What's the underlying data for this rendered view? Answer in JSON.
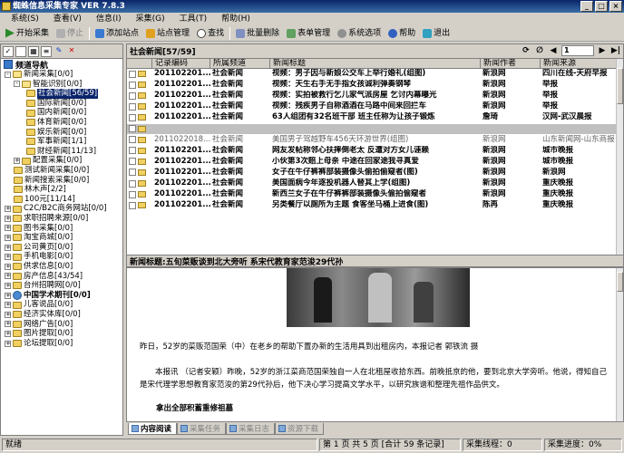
{
  "window": {
    "title": "蜘蛛信息采集专家 VER 7.8.3"
  },
  "menu": [
    "系统(S)",
    "查看(V)",
    "信息(I)",
    "采集(G)",
    "工具(T)",
    "帮助(H)"
  ],
  "toolbar": {
    "start": "开始采集",
    "stop": "停止",
    "add_site": "添加站点",
    "site_manage": "站点管理",
    "find": "查找",
    "batch_delete": "批量删除",
    "form_manage": "表单管理",
    "options": "系统选项",
    "help": "帮助",
    "exit": "退出"
  },
  "sidebar": {
    "title": "频道导航",
    "items": [
      {
        "label": "新闻采集[0/0]"
      },
      {
        "label": "智能识别[0/0]"
      },
      {
        "label": "社会新闻[56/59]"
      },
      {
        "label": "国际新闻[0/0]"
      },
      {
        "label": "国内新闻[0/0]"
      },
      {
        "label": "体育新闻[0/0]"
      },
      {
        "label": "娱乐新闻[0/0]"
      },
      {
        "label": "军事新闻[1/1]"
      },
      {
        "label": "财经新闻[11/13]"
      },
      {
        "label": "配置采集[0/0]"
      },
      {
        "label": "测试新闻采集[0/0]"
      },
      {
        "label": "新闻搜索采集[0/0]"
      },
      {
        "label": "林木声[2/2]"
      },
      {
        "label": "100元[11/14]"
      },
      {
        "label": "C2C/B2C商务网站[0/0]"
      },
      {
        "label": "求职招聘来源[0/0]"
      },
      {
        "label": "图书采集[0/0]"
      },
      {
        "label": "淘宝商城[0/0]"
      },
      {
        "label": "公司黄页[0/0]"
      },
      {
        "label": "手机电影[0/0]"
      },
      {
        "label": "供求信息[0/0]"
      },
      {
        "label": "房产信息[43/54]"
      },
      {
        "label": "台州招聘网[0/0]"
      },
      {
        "label": "中国学术期刊[0/0]"
      },
      {
        "label": "儿客说品[0/0]"
      },
      {
        "label": "经济实体库[0/0]"
      },
      {
        "label": "网络广告[0/0]"
      },
      {
        "label": "图片提取[0/0]"
      },
      {
        "label": "论坛提取[0/0]"
      }
    ]
  },
  "list": {
    "title": "社会新闻[57/59]",
    "page_select": "1",
    "columns": [
      "记录编码",
      "所属频道",
      "新闻标题",
      "新闻作者",
      "新闻来源"
    ],
    "rows": [
      {
        "id": "201102201...",
        "ch": "社会新闻",
        "title": "视频：男子因与新娘公交车上举行婚礼(组图)",
        "author": "新浪网",
        "src": "四川在线-天府早报"
      },
      {
        "id": "201102201...",
        "ch": "社会新闻",
        "title": "视频：天生右手无手指女孩诚利弹奏钢琴",
        "author": "新浪网",
        "src": "举报"
      },
      {
        "id": "201102201...",
        "ch": "社会新闻",
        "title": "视频：实拍被救行乞儿家气派房屋 乞讨内幕曝光",
        "author": "新浪网",
        "src": "举报"
      },
      {
        "id": "201102201...",
        "ch": "社会新闻",
        "title": "视频：残疾男子自称酒酒在马路中间来回拦车",
        "author": "新浪网",
        "src": "举报"
      },
      {
        "id": "201102201...",
        "ch": "社会新闻",
        "title": "63人组团有32名班干部 班主任称为让孩子锻炼",
        "author": "詹琦",
        "src": "汉网-武汉晨报"
      },
      {
        "id": "",
        "ch": "",
        "title": "",
        "author": "",
        "src": ""
      },
      {
        "id": "2011022018...",
        "ch": "社会新闻",
        "title": "美国男子驾越野车456天环游世界(组图)",
        "author": "新浪网",
        "src": "山东新闻网-山东商报"
      },
      {
        "id": "201102201...",
        "ch": "社会新闻",
        "title": "网友发帖称邻心扶摔倒老太 反遭对方女儿诬赖",
        "author": "新浪网",
        "src": "城市晚报"
      },
      {
        "id": "201102201...",
        "ch": "社会新闻",
        "title": "小伙第3次赔上母亲 中途在回家途我寻真爱",
        "author": "新浪网",
        "src": "城市晚报"
      },
      {
        "id": "201102201...",
        "ch": "社会新闻",
        "title": "女子在牛仔裤裤部装摄像头偷拍偷窥者(图)",
        "author": "新浪网",
        "src": "新浪网"
      },
      {
        "id": "201102201...",
        "ch": "社会新闻",
        "title": "美国面病今年逐投机器人替其上学(组图)",
        "author": "新浪网",
        "src": "重庆晚报"
      },
      {
        "id": "201102201...",
        "ch": "社会新闻",
        "title": "新西兰女子在牛仔裤裤部装摄像头偷拍偷窥者",
        "author": "新浪网",
        "src": "重庆晚报"
      },
      {
        "id": "201102201...",
        "ch": "社会新闻",
        "title": "另类餐厅以厕所为主题 食客坐马桶上进食(图)",
        "author": "陈再",
        "src": "重庆晚报"
      }
    ]
  },
  "detail": {
    "title": "新闻标题:五旬菜贩谈到北大旁听 系宋代教育家范浚29代孙",
    "caption": "昨日，52岁的菜贩范国荣（中）在老乡的帮助下置办新的生活用具到出租房内，本报记者 郭铁流 摄",
    "para1": "本报讯 （记者安颖）昨晚，52岁的浙江菜商范国荣独自一人在北租屋收拾东西。前晚抵京的他，要到北京大学旁听。他说，得知自己是宋代理学思想教育家范浚的第29代孙后，他下决心学习提高文学水平，以研究族谱和整理先祖作品供文。",
    "subhead": "拿出全部积蓄重修祖墓"
  },
  "tabs": [
    "内容阅读",
    "采集任务",
    "采集日志",
    "资源下载"
  ],
  "status": {
    "ready": "就绪",
    "pages": "第 1 页 共 5 页 [合计 59 条记录]",
    "threads": "采集线程：0",
    "progress": "采集进度：0%"
  }
}
